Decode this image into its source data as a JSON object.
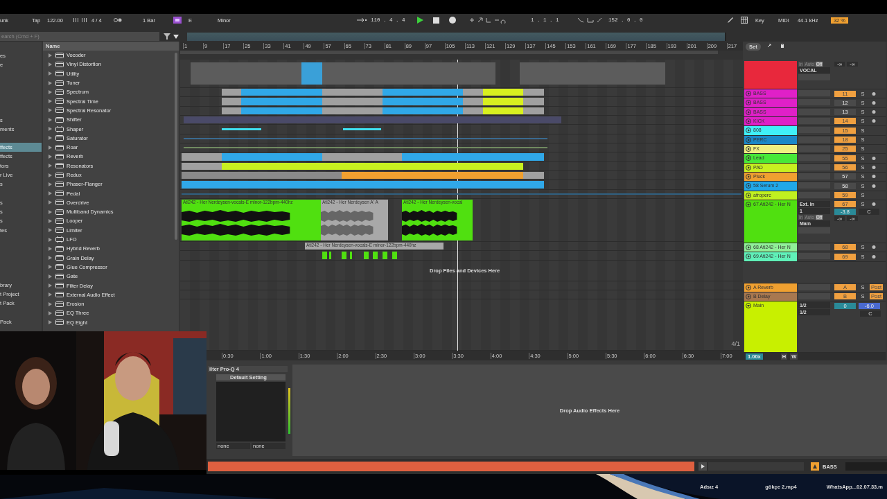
{
  "transport": {
    "link": "unk",
    "tap": "Tap",
    "tempo": "122.00",
    "signature": "4 / 4",
    "quantize": "1 Bar",
    "scale_root": "E",
    "scale_mode": "Minor",
    "position": "110 . 4 . 4",
    "loop_start": "1 . 1 . 1",
    "loop_length": "152 . 0 . 0",
    "key": "Key",
    "midi": "MIDI",
    "sample_rate": "44.1 kHz",
    "cpu": "32 %"
  },
  "browser": {
    "search": {
      "placeholder": "earch (Cmd + F)"
    },
    "places": [
      [
        {
          "label": "es",
          "selected": false
        },
        {
          "label": "e",
          "selected": false
        }
      ],
      [
        {
          "label": "s",
          "selected": false
        },
        {
          "label": "ments",
          "selected": false
        }
      ],
      [
        {
          "label": "ffects",
          "selected": true
        },
        {
          "label": "ffects",
          "selected": false
        },
        {
          "label": "tors",
          "selected": false
        },
        {
          "label": "r Live",
          "selected": false
        },
        {
          "label": "s",
          "selected": false
        }
      ],
      [
        {
          "label": "s",
          "selected": false
        },
        {
          "label": "s",
          "selected": false
        },
        {
          "label": "s",
          "selected": false
        },
        {
          "label": "tes",
          "selected": false
        }
      ],
      [
        {
          "label": "brary",
          "selected": false
        },
        {
          "label": "t Project",
          "selected": false
        },
        {
          "label": "t Pack",
          "selected": false
        }
      ],
      [
        {
          "label": "Pack",
          "selected": false
        }
      ]
    ],
    "column_header": "Name",
    "items": [
      {
        "label": "Vocoder",
        "kind": "device"
      },
      {
        "label": "Vinyl Distortion",
        "kind": "device"
      },
      {
        "label": "Utility",
        "kind": "device"
      },
      {
        "label": "Tuner",
        "kind": "device"
      },
      {
        "label": "Spectrum",
        "kind": "device"
      },
      {
        "label": "Spectral Time",
        "kind": "device"
      },
      {
        "label": "Spectral Resonator",
        "kind": "device"
      },
      {
        "label": "Shifter",
        "kind": "device"
      },
      {
        "label": "Shaper",
        "kind": "max"
      },
      {
        "label": "Saturator",
        "kind": "device"
      },
      {
        "label": "Roar",
        "kind": "device"
      },
      {
        "label": "Reverb",
        "kind": "device"
      },
      {
        "label": "Resonators",
        "kind": "device"
      },
      {
        "label": "Redux",
        "kind": "device"
      },
      {
        "label": "Phaser-Flanger",
        "kind": "device"
      },
      {
        "label": "Pedal",
        "kind": "device"
      },
      {
        "label": "Overdrive",
        "kind": "device"
      },
      {
        "label": "Multiband Dynamics",
        "kind": "device"
      },
      {
        "label": "Looper",
        "kind": "device"
      },
      {
        "label": "Limiter",
        "kind": "device"
      },
      {
        "label": "LFO",
        "kind": "max"
      },
      {
        "label": "Hybrid Reverb",
        "kind": "device"
      },
      {
        "label": "Grain Delay",
        "kind": "device"
      },
      {
        "label": "Glue Compressor",
        "kind": "device"
      },
      {
        "label": "Gate",
        "kind": "device"
      },
      {
        "label": "Filter Delay",
        "kind": "device"
      },
      {
        "label": "External Audio Effect",
        "kind": "device"
      },
      {
        "label": "Erosion",
        "kind": "device"
      },
      {
        "label": "EQ Three",
        "kind": "device"
      },
      {
        "label": "EQ Eight",
        "kind": "device"
      }
    ]
  },
  "arrangement": {
    "bar_numbers": [
      "1",
      "9",
      "17",
      "25",
      "33",
      "41",
      "49",
      "57",
      "65",
      "73",
      "81",
      "89",
      "97",
      "105",
      "113",
      "121",
      "129",
      "137",
      "145",
      "153",
      "161",
      "169",
      "177",
      "185",
      "193",
      "201",
      "209",
      "217"
    ],
    "set_button": "Set",
    "time_labels": [
      "0:30",
      "1:00",
      "1:30",
      "2:00",
      "2:30",
      "3:00",
      "3:30",
      "4:00",
      "4:30",
      "5:00",
      "5:30",
      "6:00",
      "6:30",
      "7:00"
    ],
    "drop_hint": "Drop Files and Devices Here",
    "zoom_readout": "4/1",
    "tempo_scale": "1.00x",
    "h_button": "H",
    "w_button": "W"
  },
  "tracks": [
    {
      "kind": "group",
      "color": "#e8283c",
      "monitor": [
        {
          "label": "In",
          "selected": false
        },
        {
          "label": "Auto",
          "selected": false
        },
        {
          "label": "Off",
          "selected": true
        }
      ],
      "output": "VOCAL",
      "peaks": [
        "-∞",
        "-∞"
      ]
    },
    {
      "kind": "track",
      "name": "BASS",
      "color": "#e020c8",
      "number": "11",
      "active": true,
      "solo": "S",
      "arm": true
    },
    {
      "kind": "track",
      "name": "BASS",
      "color": "#e020c8",
      "number": "12",
      "active": false,
      "solo": "S",
      "arm": true
    },
    {
      "kind": "track",
      "name": "BASS",
      "color": "#e020c8",
      "number": "13",
      "active": false,
      "solo": "S",
      "arm": true
    },
    {
      "kind": "track",
      "name": "KICK",
      "color": "#e020c8",
      "number": "14",
      "active": true,
      "solo": "S",
      "arm": true
    },
    {
      "kind": "track",
      "name": "808",
      "color": "#40f0f8",
      "number": "15",
      "active": true,
      "solo": "S",
      "arm": false
    },
    {
      "kind": "track",
      "name": "PERC",
      "color": "#1a88c8",
      "number": "18",
      "active": true,
      "solo": "S",
      "arm": false
    },
    {
      "kind": "track",
      "name": "FX",
      "color": "#f0f080",
      "number": "25",
      "active": true,
      "solo": "S",
      "arm": false
    },
    {
      "kind": "track",
      "name": "Lead",
      "color": "#48e838",
      "number": "55",
      "active": true,
      "solo": "S",
      "arm": true
    },
    {
      "kind": "track",
      "name": "PAD",
      "color": "#c8f020",
      "number": "56",
      "active": true,
      "solo": "S",
      "arm": true
    },
    {
      "kind": "track",
      "name": "Pluck",
      "color": "#f0a030",
      "number": "57",
      "active": false,
      "solo": "S",
      "arm": true
    },
    {
      "kind": "track",
      "name": "58 Serum 2",
      "color": "#20a8e8",
      "number": "58",
      "active": false,
      "solo": "S",
      "arm": true
    },
    {
      "kind": "track",
      "name": "afroperc",
      "color": "#c0f020",
      "number": "59",
      "active": true,
      "solo": "S",
      "arm": false
    },
    {
      "kind": "expanded",
      "name": "67 Ati242 - Her N",
      "color": "#50e010",
      "number": "67",
      "active": true,
      "solo": "S",
      "arm": true,
      "input": "Ext. In",
      "channel": "1",
      "volume": "-3.8",
      "pan": "C",
      "monitor": [
        {
          "label": "In",
          "selected": false
        },
        {
          "label": "Auto",
          "selected": false
        },
        {
          "label": "Off",
          "selected": true
        }
      ],
      "output": "Main",
      "peaks": [
        "-∞",
        "-∞"
      ],
      "clips": [
        {
          "label": "Ati242 - Her Nerdeysen-vocals-E minor-122bpm-440hz"
        },
        {
          "label": "Ati242 - Her Nerdeysen A' A"
        },
        {
          "label": "Ati242 - Her Nerdeysen-vocal"
        }
      ]
    },
    {
      "kind": "track",
      "name": "68 Ati242 - Her N",
      "color": "#90f098",
      "number": "68",
      "active": true,
      "solo": "S",
      "arm": true,
      "clips": [
        {
          "label": "Ati242 - Her Nerdeysen-vocals-E minor-122bpm-440hz"
        }
      ]
    },
    {
      "kind": "track",
      "name": "69 Ati242 - Her N",
      "color": "#60f0b8",
      "number": "69",
      "active": true,
      "solo": "S",
      "arm": true
    }
  ],
  "returns": [
    {
      "name": "A Reverb",
      "color": "#f0a030",
      "letter": "A",
      "solo": "S",
      "send_mode": "Post"
    },
    {
      "name": "B Delay",
      "color": "#a87850",
      "letter": "B",
      "solo": "S",
      "send_mode": "Post"
    }
  ],
  "main": {
    "name": "Main",
    "color": "#c8f000",
    "inputs": [
      "1/2",
      "1/2"
    ],
    "volume": "0",
    "pan_value": "-6.0",
    "pan": "C"
  },
  "device": {
    "title": "ilter Pro-Q 4",
    "preset": "Default Setting",
    "params": [
      "none",
      "none"
    ],
    "drop_hint": "Drop Audio Effects Here"
  },
  "status": {
    "track": "BASS"
  },
  "desktop": {
    "files": [
      "Adsız 4",
      "gökçe 2.mp4",
      "WhatsApp...02.07.33.m"
    ]
  }
}
